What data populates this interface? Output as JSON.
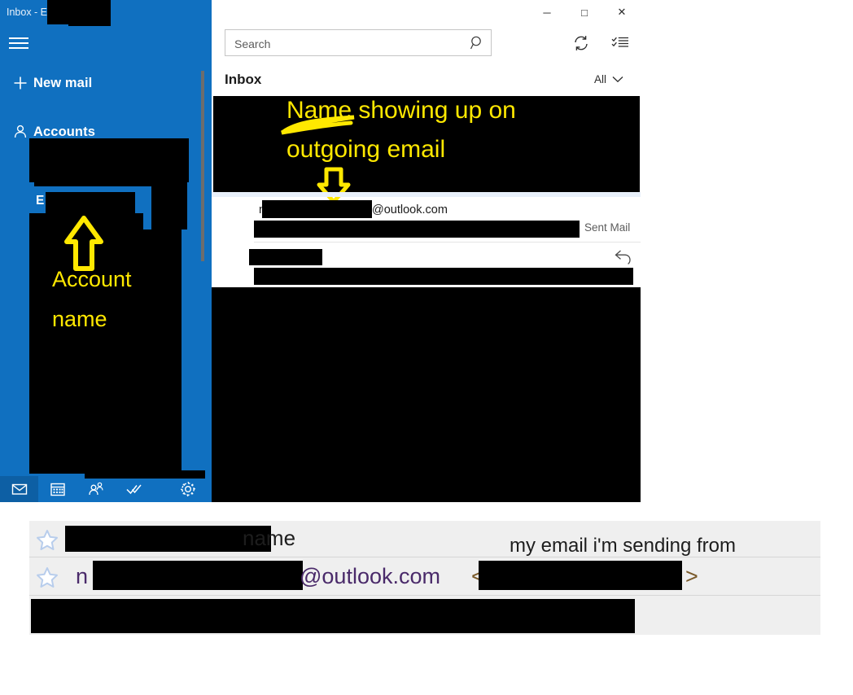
{
  "window": {
    "title": "Inbox - E",
    "controls": {
      "minimize": "─",
      "maximize": "□",
      "close": "✕"
    }
  },
  "sidebar": {
    "hamburger_name": "hamburger-menu",
    "items": [
      {
        "label": "New mail",
        "icon": "plus-icon"
      },
      {
        "label": "Accounts",
        "icon": "person-icon"
      }
    ],
    "bottom_nav": [
      {
        "icon": "mail-icon",
        "label": "Mail",
        "active": true
      },
      {
        "icon": "calendar-icon",
        "label": "Calendar",
        "active": false
      },
      {
        "icon": "people-icon",
        "label": "People",
        "active": false
      },
      {
        "icon": "todo-icon",
        "label": "To Do",
        "active": false
      },
      {
        "icon": "gear-icon",
        "label": "Settings",
        "active": false
      }
    ],
    "account_letter": "E"
  },
  "search": {
    "value": "",
    "placeholder": "Search",
    "icon": "search-icon"
  },
  "toolbar": {
    "sync_icon": "sync-icon",
    "select_icon": "select-mode-icon"
  },
  "list": {
    "title": "Inbox",
    "filter_label": "All",
    "filter_chevron": "chevron-down-icon",
    "messages": [
      {
        "from_prefix": "n",
        "from_suffix": "@outlook.com",
        "folder": "Sent Mail",
        "reply_icon": ""
      },
      {
        "from_prefix": "",
        "from_suffix": "",
        "folder": "",
        "reply_icon": "reply-icon"
      }
    ]
  },
  "annotations": [
    {
      "name": "annotation-outgoing-name",
      "line1": "Name showing up on",
      "line2": "outgoing email",
      "arrow": "down-arrow",
      "color": "#ffe800"
    },
    {
      "name": "annotation-account-name",
      "line1": "Account",
      "line2": "name",
      "arrow": "up-arrow",
      "color": "#ffe800"
    }
  ],
  "bottom_panel": {
    "rows": [
      {
        "star_icon": "star-icon",
        "label": "name",
        "note": "my email i'm sending from"
      },
      {
        "star_icon": "star-icon",
        "prefix": "n",
        "domain": "@outlook.com",
        "bracket_open": "<",
        "bracket_close": ">"
      }
    ]
  },
  "colors": {
    "accent_blue": "#1070c0",
    "accent_blue_dark": "#0d5fa4",
    "annotation_yellow": "#ffe800",
    "redaction_black": "#000000",
    "panel_gray": "#efefef",
    "selection_blue": "#e8f0fa"
  }
}
